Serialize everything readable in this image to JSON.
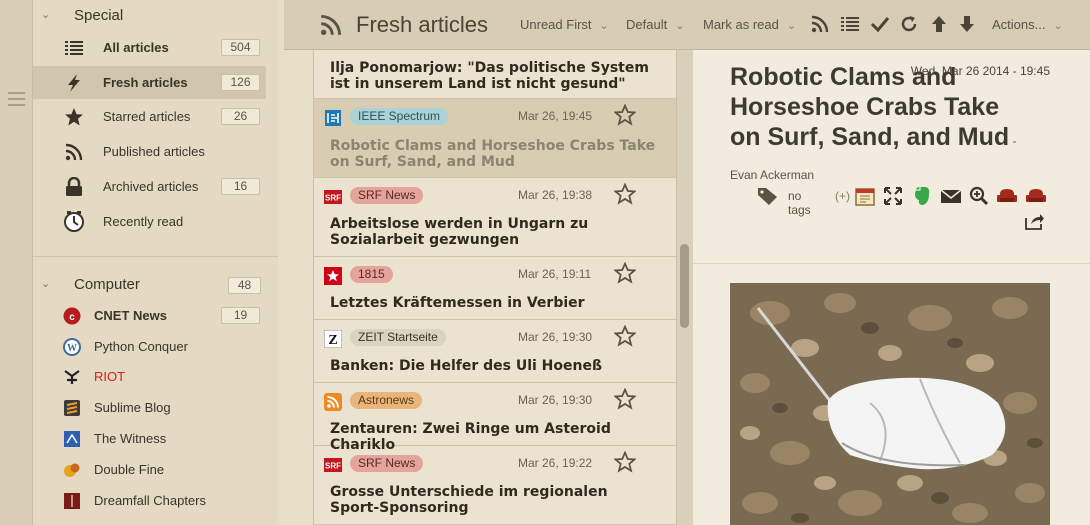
{
  "sidebar": {
    "special_label": "Special",
    "special_items": [
      {
        "label": "All articles",
        "count": "504"
      },
      {
        "label": "Fresh articles",
        "count": "126"
      },
      {
        "label": "Starred articles",
        "count": "26"
      },
      {
        "label": "Published articles",
        "count": ""
      },
      {
        "label": "Archived articles",
        "count": "16"
      },
      {
        "label": "Recently read",
        "count": ""
      }
    ],
    "computer_label": "Computer",
    "computer_count": "48",
    "computer_items": [
      {
        "label": "CNET News",
        "count": "19"
      },
      {
        "label": "Python Conquer",
        "count": ""
      },
      {
        "label": "RIOT",
        "count": ""
      },
      {
        "label": "Sublime Blog",
        "count": ""
      },
      {
        "label": "The Witness",
        "count": ""
      },
      {
        "label": "Double Fine",
        "count": ""
      },
      {
        "label": "Dreamfall Chapters",
        "count": ""
      }
    ]
  },
  "toolbar": {
    "title": "Fresh articles",
    "order": "Unread First",
    "view": "Default",
    "mark": "Mark as read",
    "actions": "Actions..."
  },
  "list": {
    "first_title": "Ilja Ponomarjow: \"Das politische System ist in unserem Land ist nicht gesund\"",
    "rows": [
      {
        "feed": "IEEE Spectrum",
        "date": "Mar 26, 19:45",
        "title": "Robotic Clams and Horseshoe Crabs Take on Surf, Sand, and Mud"
      },
      {
        "feed": "SRF News",
        "date": "Mar 26, 19:38",
        "title": "Arbeitslose werden in Ungarn zu Sozialarbeit gezwungen"
      },
      {
        "feed": "1815",
        "date": "Mar 26, 19:11",
        "title": "Letztes Kräftemessen in Verbier"
      },
      {
        "feed": "ZEIT Startseite",
        "date": "Mar 26, 19:30",
        "title": "Banken: Die Helfer des Uli Hoeneß"
      },
      {
        "feed": "Astronews",
        "date": "Mar 26, 19:30",
        "title": "Zentauren: Zwei Ringe um Asteroid Chariklo"
      },
      {
        "feed": "SRF News",
        "date": "Mar 26, 19:22",
        "title": "Grosse Unterschiede im regionalen Sport-Sponsoring"
      }
    ]
  },
  "article": {
    "title": "Robotic Clams and Horseshoe Crabs Take on Surf, Sand, and Mud",
    "author": " - Evan Ackerman",
    "date": "Wed, Mar 26 2014 - 19:45",
    "tags": "no tags",
    "tags_add": "(+)"
  },
  "colors": {
    "ieee_tag": "#a9d3d8",
    "srf_tag": "#e4a39b",
    "1815_tag": "#e4a39b",
    "zeit_tag": "#d9d3c3",
    "astro_tag": "#e8b57c"
  }
}
